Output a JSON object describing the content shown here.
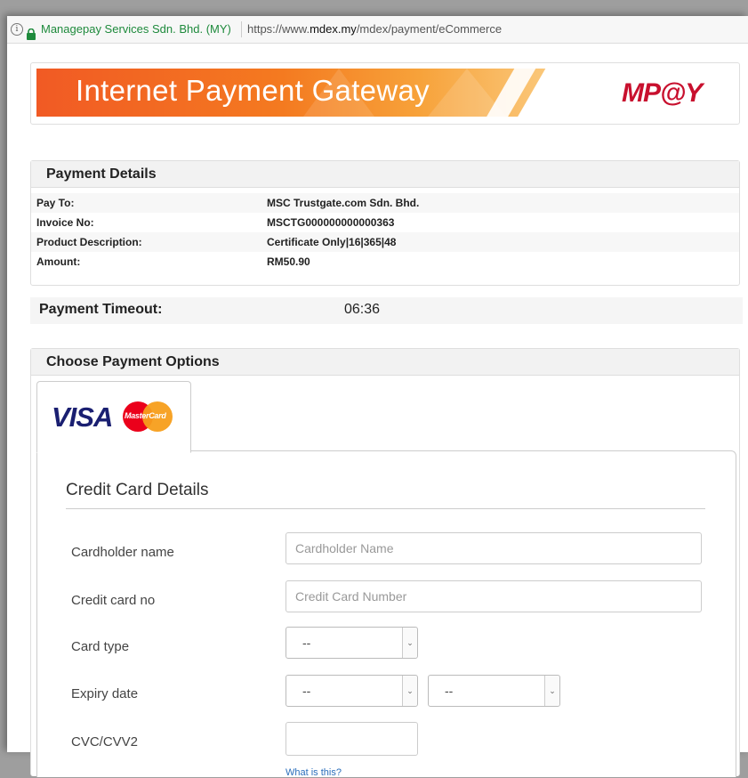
{
  "addressbar": {
    "company": "Managepay Services Sdn. Bhd. (MY)",
    "url_prefix": "https://www.",
    "url_domain": "mdex.my",
    "url_path": "/mdex/payment/eCommerce"
  },
  "banner": {
    "title": "Internet Payment Gateway",
    "logo_text": "MP@Y"
  },
  "payment_details": {
    "heading": "Payment Details",
    "rows": [
      {
        "label": "Pay To:",
        "value": "MSC Trustgate.com Sdn. Bhd."
      },
      {
        "label": "Invoice No:",
        "value": "MSCTG000000000000363"
      },
      {
        "label": "Product Description:",
        "value": "Certificate Only|16|365|48"
      },
      {
        "label": "Amount:",
        "value": "RM50.90"
      }
    ]
  },
  "timeout": {
    "label": "Payment Timeout:",
    "value": "06:36"
  },
  "payment_options": {
    "heading": "Choose Payment Options",
    "tab": {
      "visa": "VISA",
      "mastercard": "MasterCard"
    }
  },
  "credit_card": {
    "title": "Credit Card Details",
    "cardholder": {
      "label": "Cardholder name",
      "placeholder": "Cardholder Name"
    },
    "card_no": {
      "label": "Credit card no",
      "placeholder": "Credit Card Number"
    },
    "card_type": {
      "label": "Card type",
      "value": "--"
    },
    "expiry": {
      "label": "Expiry date",
      "month": "--",
      "year": "--"
    },
    "cvc": {
      "label": "CVC/CVV2",
      "help_link": "What is this?"
    }
  },
  "colors": {
    "accent_orange": "#f15a24",
    "secure_green": "#1e8a3c",
    "logo_red": "#c8102e",
    "link_blue": "#2a6ebb"
  }
}
